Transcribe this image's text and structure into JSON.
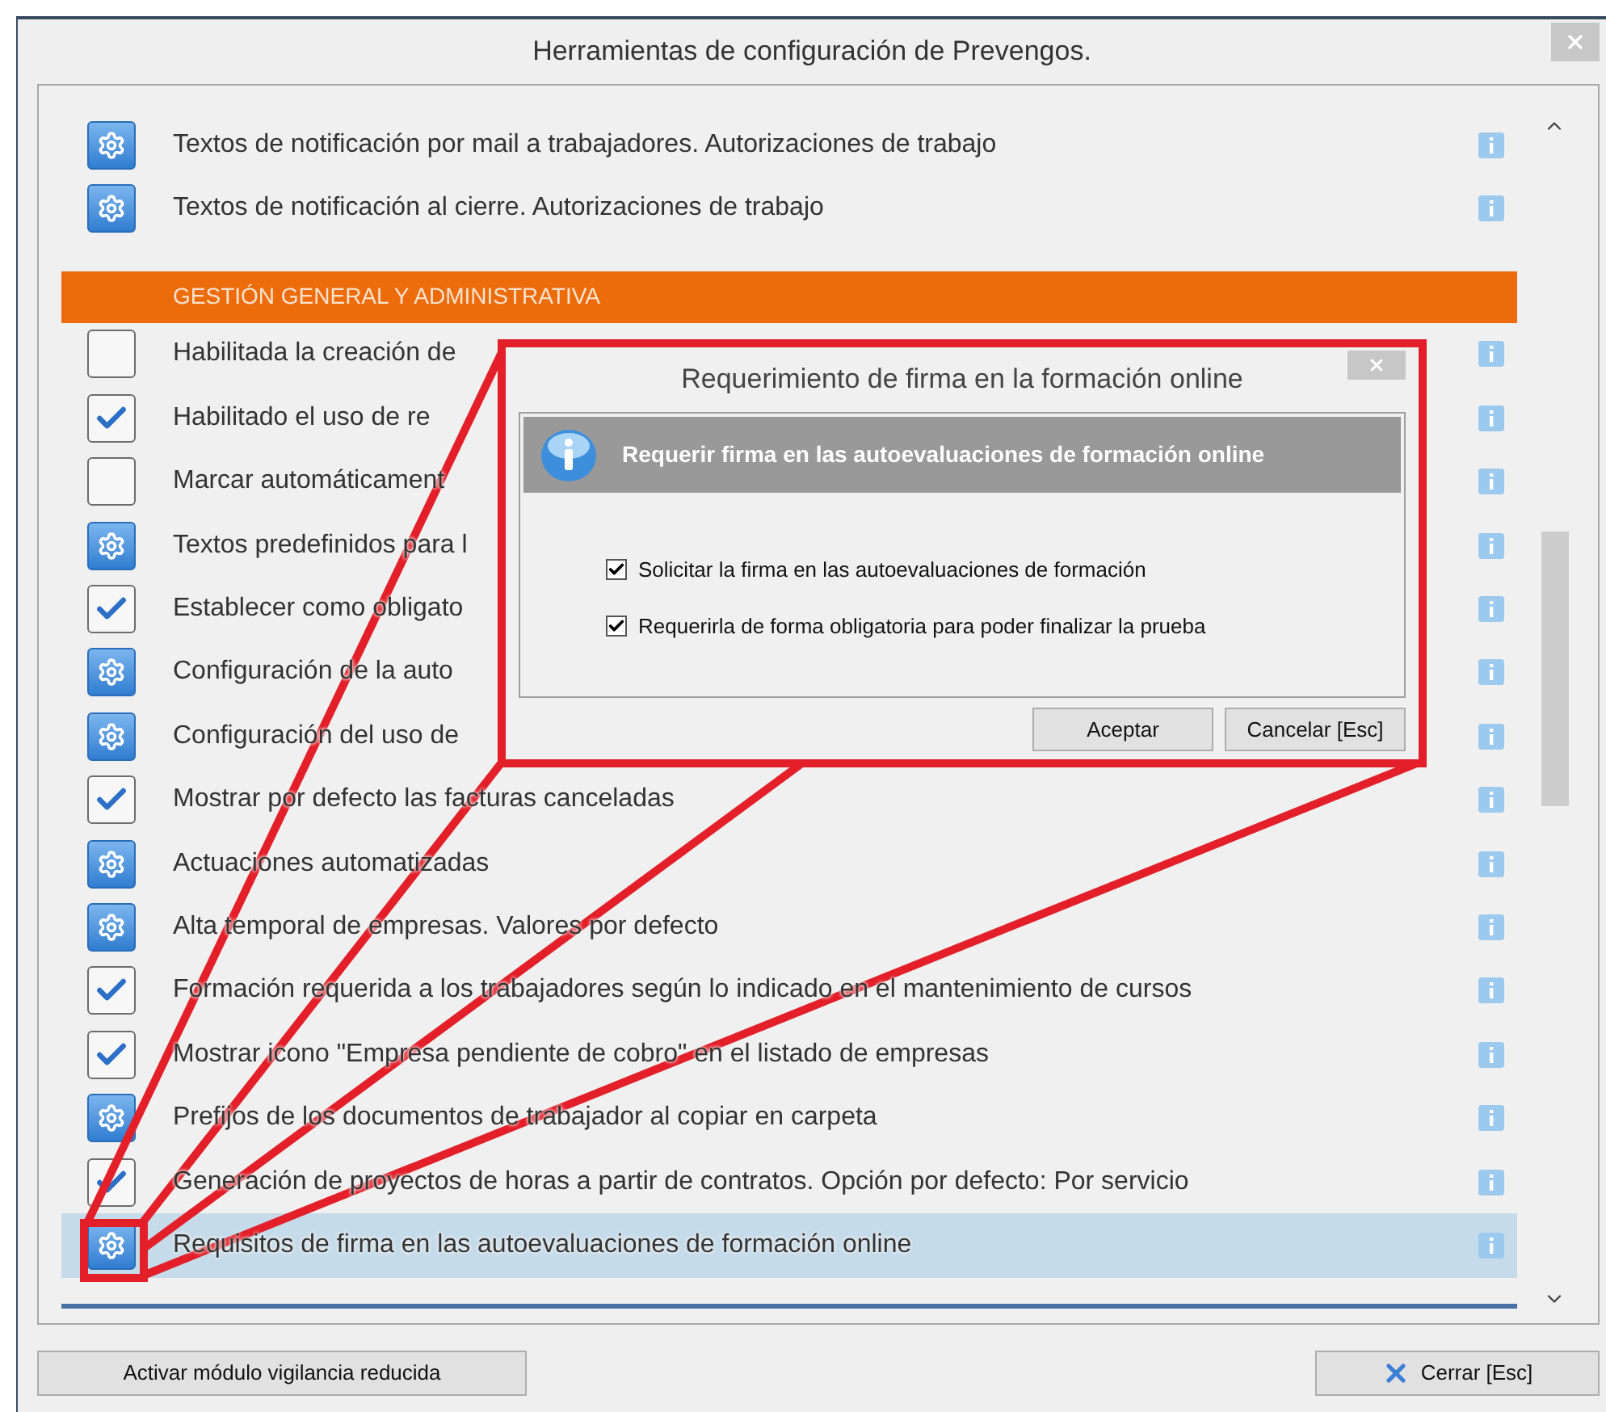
{
  "window": {
    "title": "Herramientas de configuración de Prevengos."
  },
  "items": [
    {
      "kind": "gear",
      "label": "Textos de notificación por mail a trabajadores. Autorizaciones de trabajo",
      "selected": false
    },
    {
      "kind": "gear",
      "label": "Textos de notificación al cierre. Autorizaciones de trabajo",
      "selected": false
    },
    {
      "kind": "section",
      "label": "GESTIÓN GENERAL Y ADMINISTRATIVA"
    },
    {
      "kind": "checkbox",
      "label": "Habilitada la creación de",
      "checked": false,
      "selected": false
    },
    {
      "kind": "checkbox",
      "label": "Habilitado el uso de re",
      "checked": true,
      "selected": false
    },
    {
      "kind": "checkbox",
      "label": "Marcar automáticament",
      "checked": false,
      "selected": false
    },
    {
      "kind": "gear",
      "label": "Textos predefinidos para l",
      "selected": false
    },
    {
      "kind": "checkbox",
      "label": "Establecer como obligato",
      "checked": true,
      "selected": false
    },
    {
      "kind": "gear",
      "label": "Configuración de la auto",
      "selected": false
    },
    {
      "kind": "gear",
      "label": "Configuración del uso de",
      "selected": false
    },
    {
      "kind": "checkbox",
      "label": "Mostrar por defecto las facturas canceladas",
      "checked": true,
      "selected": false
    },
    {
      "kind": "gear",
      "label": "Actuaciones automatizadas",
      "selected": false
    },
    {
      "kind": "gear",
      "label": "Alta temporal de empresas. Valores por defecto",
      "selected": false
    },
    {
      "kind": "checkbox",
      "label": "Formación requerida a los trabajadores según lo indicado en el mantenimiento de cursos",
      "checked": true,
      "selected": false
    },
    {
      "kind": "checkbox",
      "label": "Mostrar icono \"Empresa pendiente de cobro\" en el listado de empresas",
      "checked": true,
      "selected": false
    },
    {
      "kind": "gear",
      "label": "Prefijos de los documentos de trabajador al copiar en carpeta",
      "selected": false
    },
    {
      "kind": "checkbox",
      "label": "Generación de proyectos de horas a partir de contratos. Opción por defecto: Por servicio",
      "checked": true,
      "selected": false
    },
    {
      "kind": "gear",
      "label": "Requisitos de firma en las autoevaluaciones de formación online",
      "selected": true
    }
  ],
  "buttons": {
    "left": "Activar módulo vigilancia reducida",
    "close": "Cerrar [Esc]"
  },
  "dialog": {
    "title": "Requerimiento de firma en la formación online",
    "header": "Requerir firma en las autoevaluaciones de formación online",
    "options": [
      {
        "label": "Solicitar la firma en las autoevaluaciones de formación",
        "checked": true
      },
      {
        "label": "Requerirla de forma obligatoria para poder finalizar la prueba",
        "checked": true
      }
    ],
    "buttons": [
      "Aceptar",
      "Cancelar [Esc]"
    ]
  }
}
